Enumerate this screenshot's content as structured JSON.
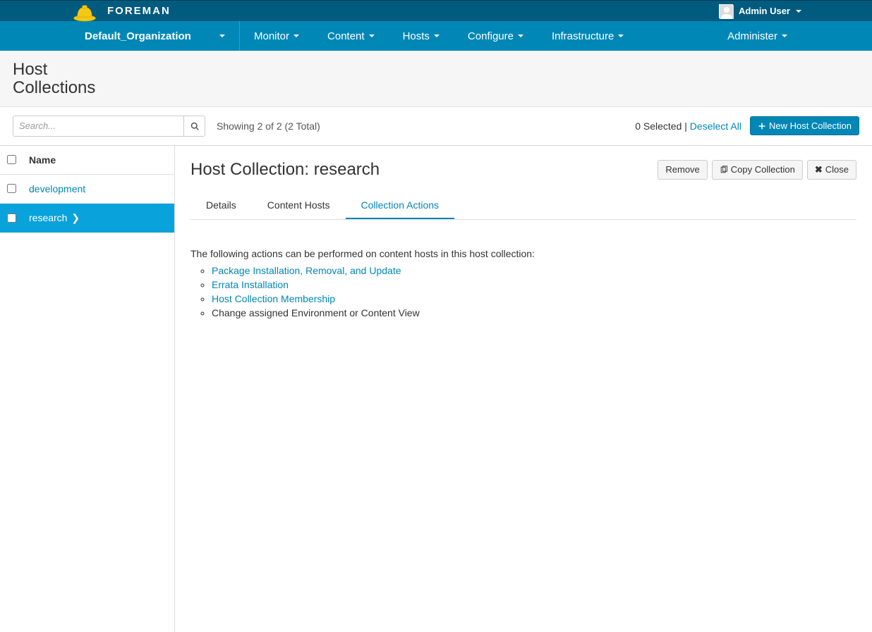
{
  "topbar": {
    "brand": "FOREMAN",
    "user": "Admin User"
  },
  "nav": {
    "org": "Default_Organization",
    "items": [
      "Monitor",
      "Content",
      "Hosts",
      "Configure",
      "Infrastructure"
    ],
    "admin": "Administer"
  },
  "page": {
    "title": "Host Collections"
  },
  "toolbar": {
    "search_placeholder": "Search...",
    "showing": "Showing 2 of 2 (2 Total)",
    "selected": "0 Selected",
    "separator": " | ",
    "deselect": "Deselect All",
    "new_btn": "New Host Collection"
  },
  "list": {
    "header": "Name",
    "rows": [
      {
        "name": "development",
        "active": false
      },
      {
        "name": "research",
        "active": true
      }
    ]
  },
  "detail": {
    "title_prefix": "Host Collection:",
    "title_name": "research",
    "buttons": {
      "remove": "Remove",
      "copy": "Copy Collection",
      "close": "Close"
    },
    "tabs": [
      "Details",
      "Content Hosts",
      "Collection Actions"
    ],
    "active_tab": 2,
    "intro": "The following actions can be performed on content hosts in this host collection:",
    "actions": [
      {
        "label": "Package Installation, Removal, and Update",
        "link": true
      },
      {
        "label": "Errata Installation",
        "link": true
      },
      {
        "label": "Host Collection Membership",
        "link": true
      },
      {
        "label": "Change assigned Environment or Content View",
        "link": false
      }
    ]
  }
}
